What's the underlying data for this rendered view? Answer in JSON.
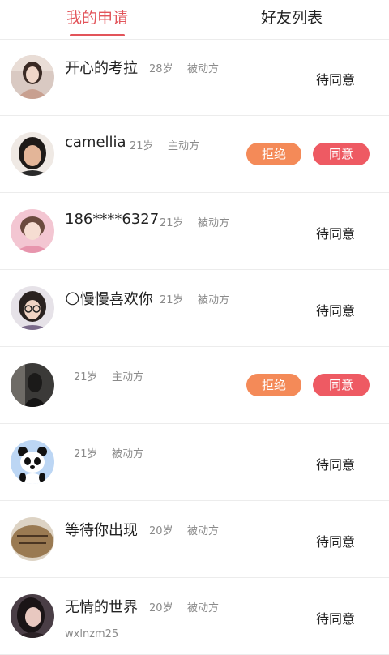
{
  "tabs": [
    {
      "label": "我的申请",
      "active": true
    },
    {
      "label": "好友列表",
      "active": false
    }
  ],
  "colors": {
    "accent": "#e2545a",
    "reject": "#f48a58",
    "accept": "#ee5a63",
    "meta": "#8a8a8a"
  },
  "requests": [
    {
      "name": "开心的考拉",
      "age": "28岁",
      "role": "被动方",
      "sub": "",
      "status": "待同意",
      "reject_label": "",
      "accept_label": "",
      "avatar_icon": "woman-photo-avatar"
    },
    {
      "name": "camellia",
      "age": "21岁",
      "role": "主动方",
      "sub": "",
      "status": "",
      "reject_label": "拒绝",
      "accept_label": "同意",
      "avatar_icon": "girl-photo-avatar"
    },
    {
      "name": "186****6327",
      "age": "21岁",
      "role": "被动方",
      "sub": "",
      "status": "待同意",
      "reject_label": "",
      "accept_label": "",
      "avatar_icon": "pink-photo-avatar"
    },
    {
      "name": "🌕慢慢喜欢你",
      "age": "21岁",
      "role": "被动方",
      "sub": "",
      "status": "待同意",
      "reject_label": "",
      "accept_label": "",
      "avatar_icon": "glasses-girl-avatar"
    },
    {
      "name": "",
      "age": "21岁",
      "role": "主动方",
      "sub": "",
      "status": "",
      "reject_label": "拒绝",
      "accept_label": "同意",
      "avatar_icon": "dark-photo-avatar"
    },
    {
      "name": "",
      "age": "21岁",
      "role": "被动方",
      "sub": "",
      "status": "待同意",
      "reject_label": "",
      "accept_label": "",
      "avatar_icon": "panda-avatar"
    },
    {
      "name": "等待你出现",
      "age": "20岁",
      "role": "被动方",
      "sub": "",
      "status": "待同意",
      "reject_label": "",
      "accept_label": "",
      "avatar_icon": "brown-text-avatar"
    },
    {
      "name": "无情的世界",
      "age": "20岁",
      "role": "被动方",
      "sub": "wxlnzm25",
      "status": "待同意",
      "reject_label": "",
      "accept_label": "",
      "avatar_icon": "dark-hair-girl-avatar"
    }
  ]
}
